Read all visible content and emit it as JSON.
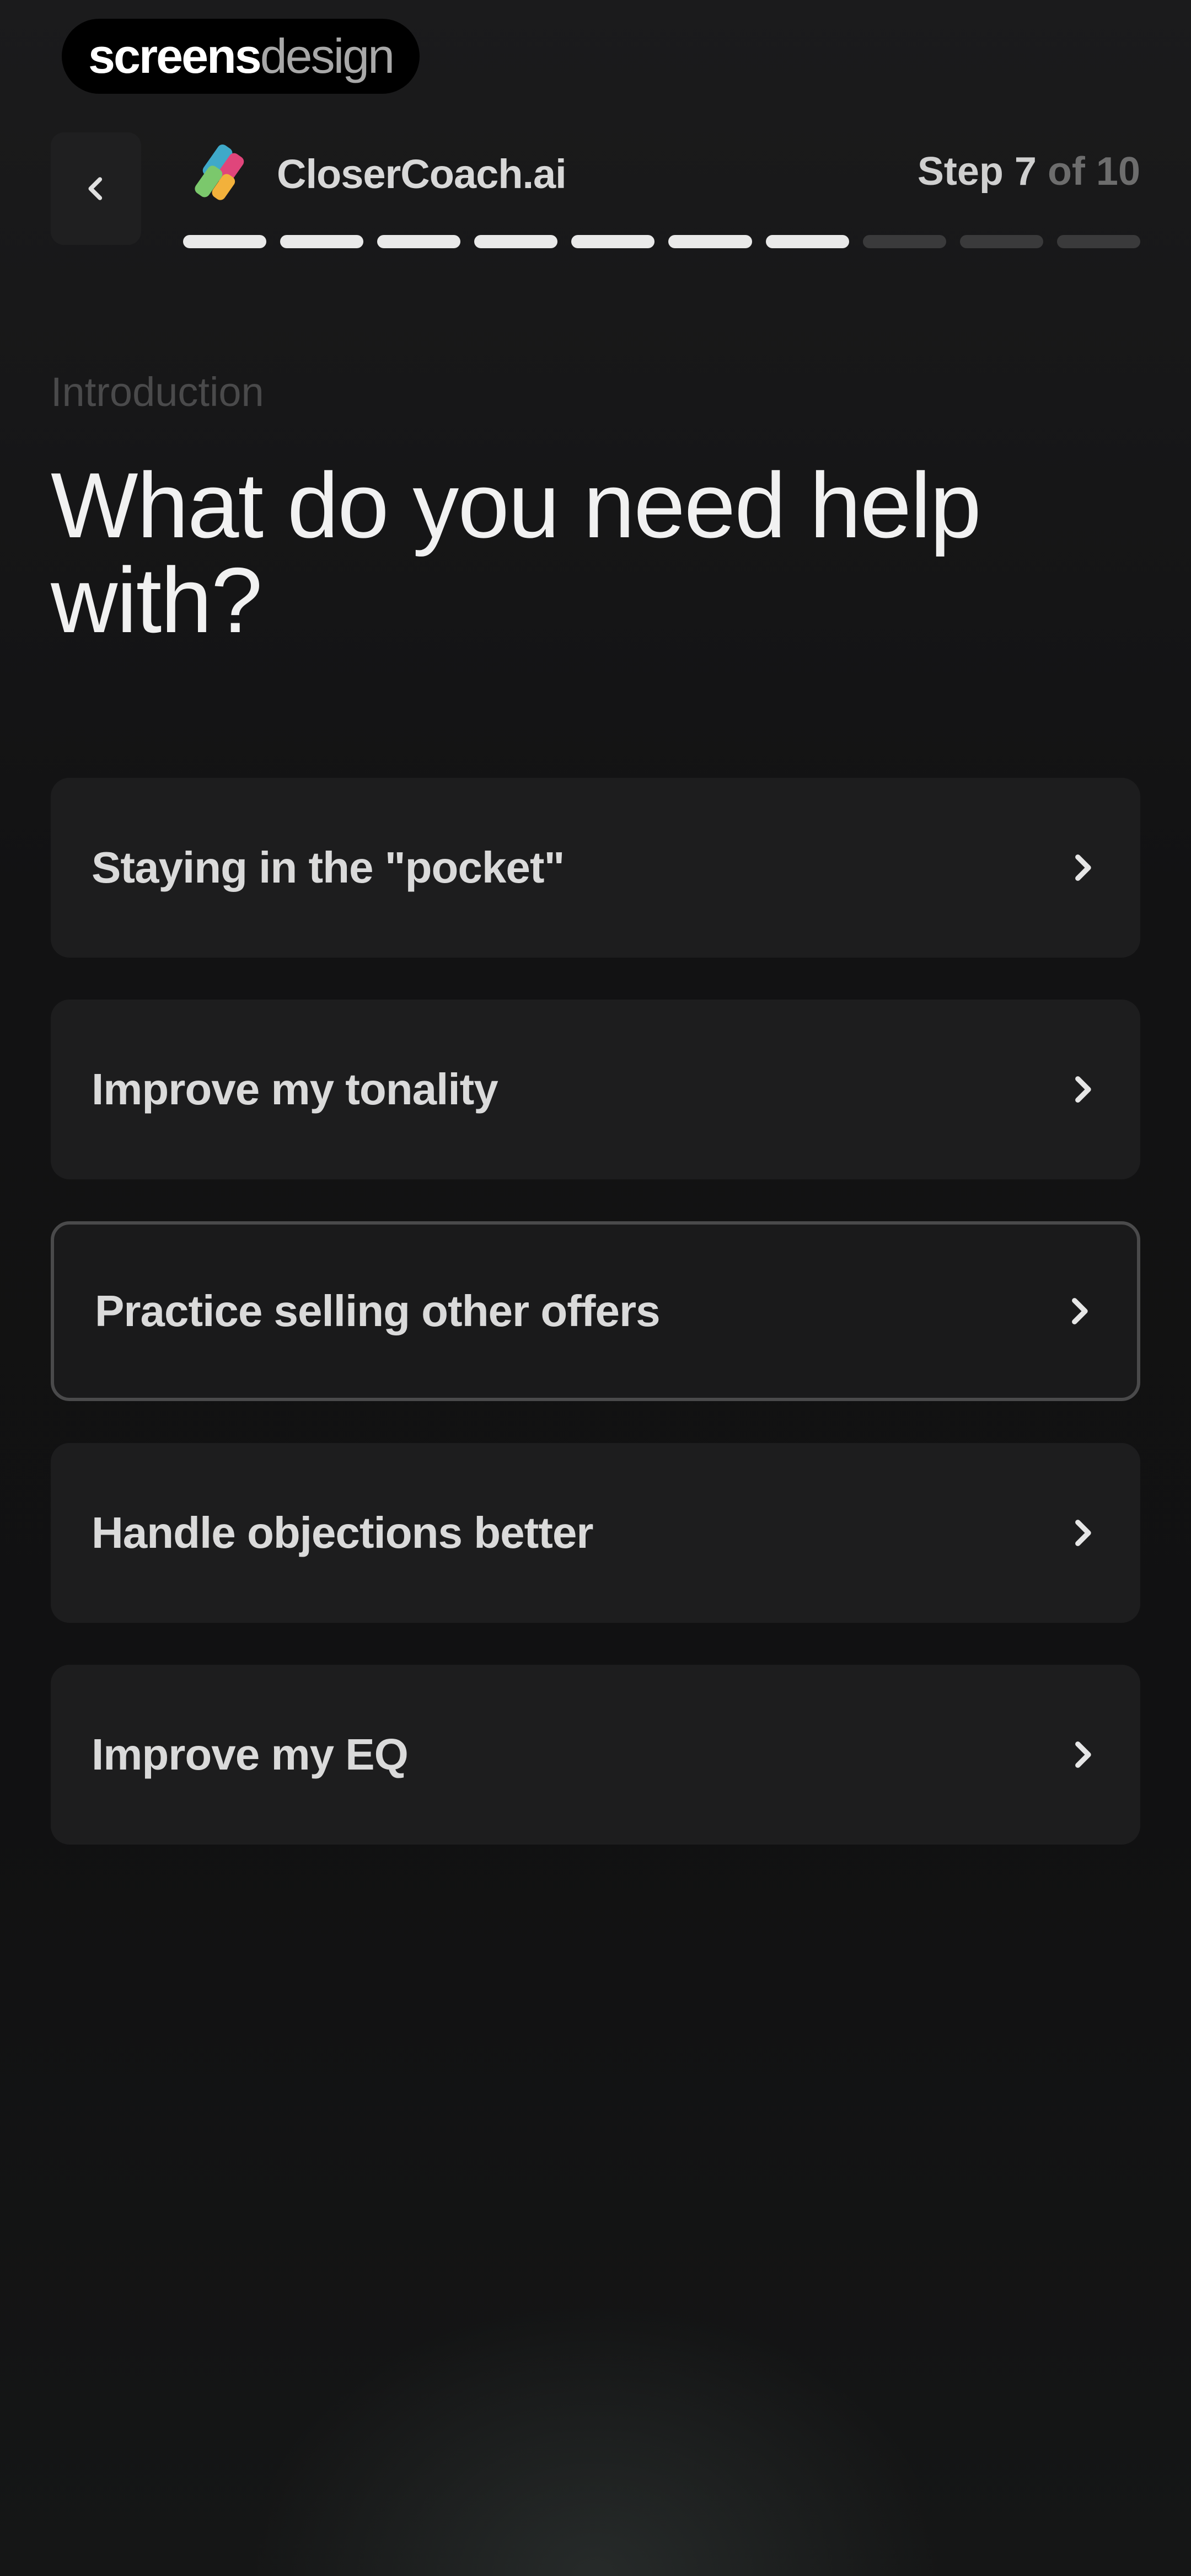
{
  "watermark": {
    "strong": "screens",
    "light": "design"
  },
  "header": {
    "brand_name": "CloserCoach.ai",
    "step_prefix": "Step 7",
    "step_suffix": "of 10",
    "step_current": 7,
    "step_total": 10
  },
  "section_label": "Introduction",
  "title": "What do you need help with?",
  "options": [
    {
      "label": "Staying in the \"pocket\"",
      "selected": false
    },
    {
      "label": "Improve my tonality",
      "selected": false
    },
    {
      "label": "Practice selling other offers",
      "selected": true
    },
    {
      "label": "Handle objections better",
      "selected": false
    },
    {
      "label": "Improve my EQ",
      "selected": false
    }
  ],
  "icons": {
    "back": "chevron-left-icon",
    "option_arrow": "chevron-right-icon",
    "brand_logo": "brand-logo-icon"
  },
  "colors": {
    "background": "#111112",
    "card": "#1d1d1e",
    "selected_border": "#4a4a4b",
    "progress_done": "#e9e9e9",
    "progress_todo": "#3a3a3b"
  }
}
